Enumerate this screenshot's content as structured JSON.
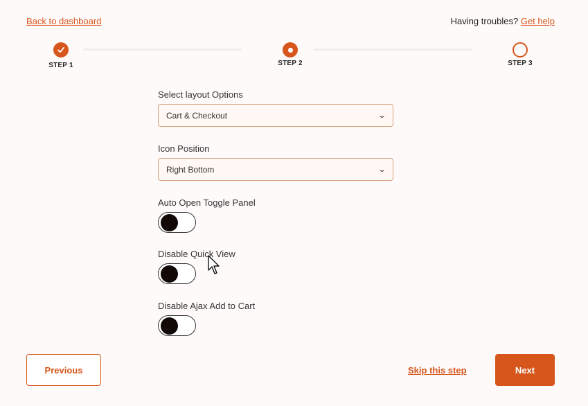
{
  "header": {
    "back_link": "Back to dashboard",
    "help_prefix": "Having troubles?",
    "help_link": "Get help"
  },
  "stepper": {
    "steps": [
      {
        "label": "STEP 1",
        "state": "completed"
      },
      {
        "label": "STEP 2",
        "state": "current"
      },
      {
        "label": "STEP 3",
        "state": "upcoming"
      }
    ]
  },
  "form": {
    "layout_label": "Select layout Options",
    "layout_value": "Cart & Checkout",
    "icon_position_label": "Icon Position",
    "icon_position_value": "Right Bottom",
    "toggles": [
      {
        "label": "Auto Open Toggle Panel",
        "enabled": false
      },
      {
        "label": "Disable Quick View",
        "enabled": false
      },
      {
        "label": "Disable Ajax Add to Cart",
        "enabled": false
      }
    ]
  },
  "footer": {
    "previous_label": "Previous",
    "skip_label": "Skip this step",
    "next_label": "Next"
  },
  "colors": {
    "accent": "#d6561c",
    "background": "#fffafa"
  }
}
